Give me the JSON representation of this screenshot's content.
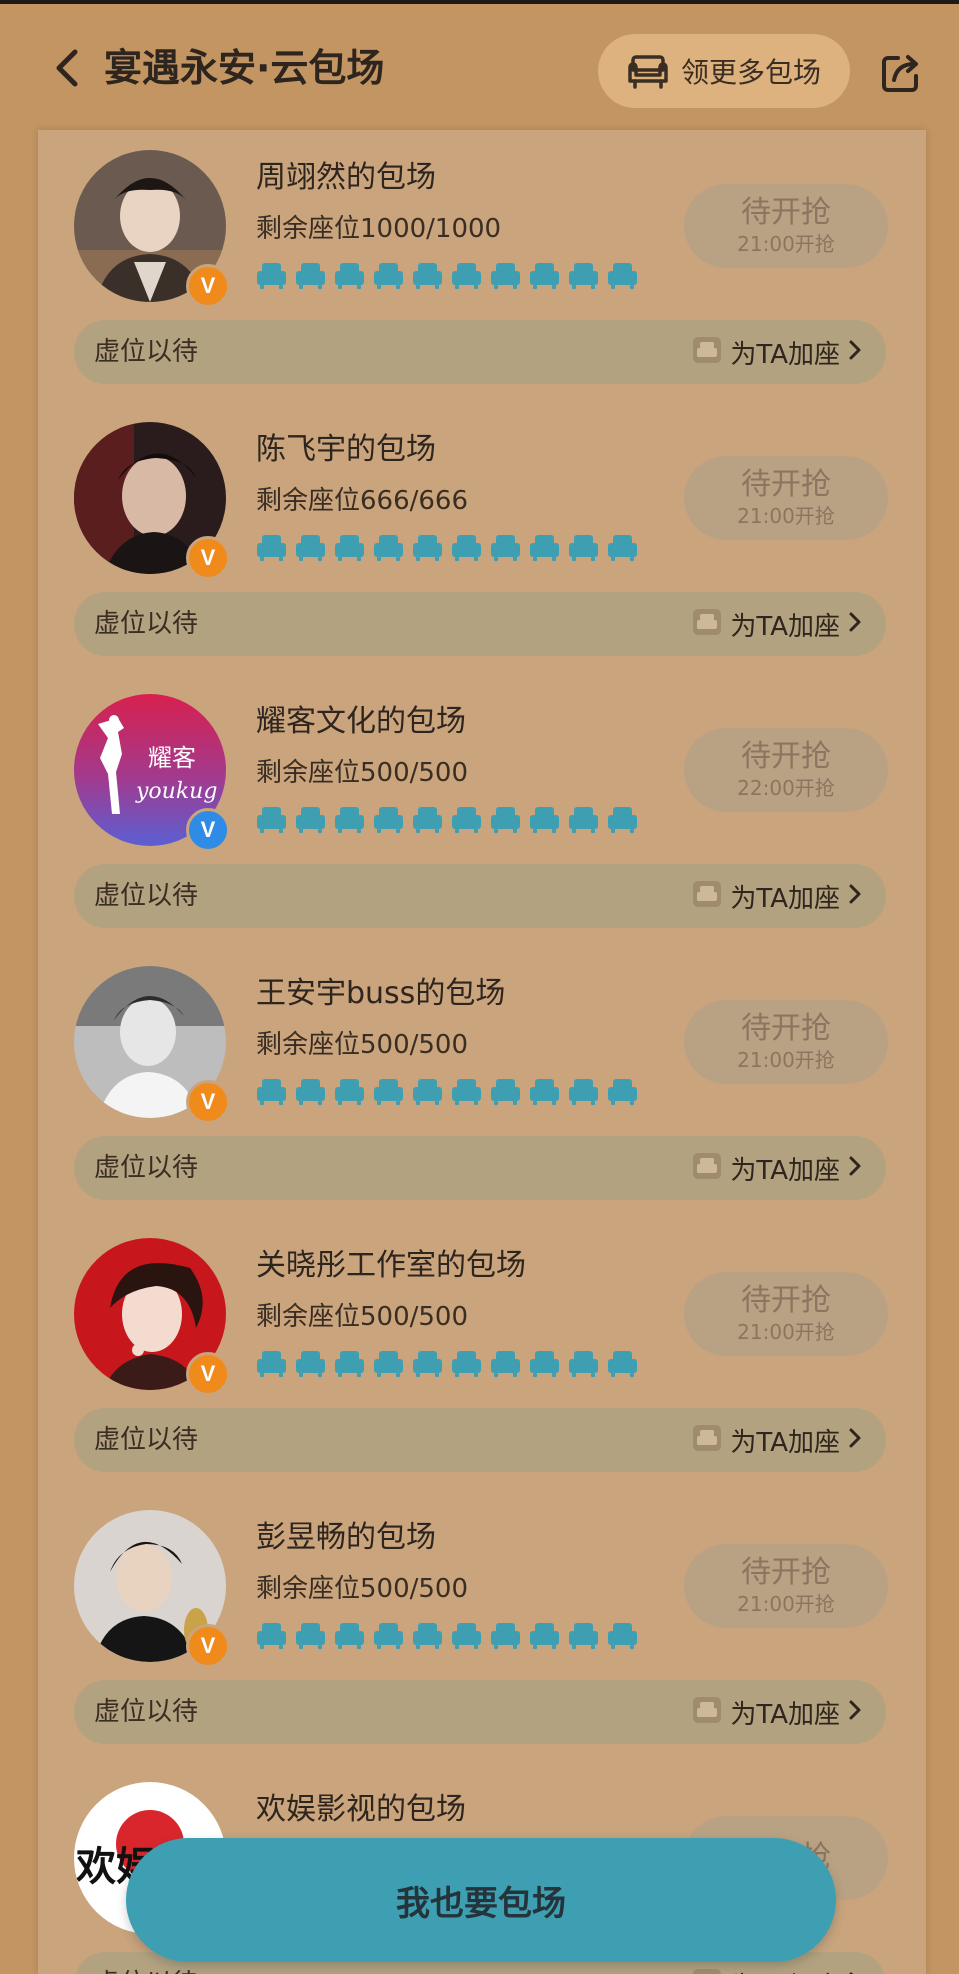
{
  "header": {
    "title": "宴遇永安·云包场",
    "more_button_label": "领更多包场",
    "icons": [
      "back-arrow-icon",
      "sofa-icon",
      "share-icon"
    ]
  },
  "colors": {
    "background": "#C29563",
    "panel": "#C9A47D",
    "seat_icon": "#3E9FB2",
    "cta": "#3E9FB2",
    "verified_orange": "#F08A1A",
    "verified_blue": "#2E8BE6"
  },
  "cards": [
    {
      "name": "周翊然的包场",
      "seats": "剩余座位1000/1000",
      "status": "待开抢",
      "time": "21:00开抢",
      "waiting": "虚位以待",
      "add_seat": "为TA加座",
      "badge": "orange"
    },
    {
      "name": "陈飞宇的包场",
      "seats": "剩余座位666/666",
      "status": "待开抢",
      "time": "21:00开抢",
      "waiting": "虚位以待",
      "add_seat": "为TA加座",
      "badge": "orange"
    },
    {
      "name": "耀客文化的包场",
      "seats": "剩余座位500/500",
      "status": "待开抢",
      "time": "22:00开抢",
      "waiting": "虚位以待",
      "add_seat": "为TA加座",
      "badge": "blue",
      "logo_text": "耀客",
      "logo_subtext": "youkug"
    },
    {
      "name": "王安宇buss的包场",
      "seats": "剩余座位500/500",
      "status": "待开抢",
      "time": "21:00开抢",
      "waiting": "虚位以待",
      "add_seat": "为TA加座",
      "badge": "orange"
    },
    {
      "name": "关晓彤工作室的包场",
      "seats": "剩余座位500/500",
      "status": "待开抢",
      "time": "21:00开抢",
      "waiting": "虚位以待",
      "add_seat": "为TA加座",
      "badge": "orange"
    },
    {
      "name": "彭昱畅的包场",
      "seats": "剩余座位500/500",
      "status": "待开抢",
      "time": "21:00开抢",
      "waiting": "虚位以待",
      "add_seat": "为TA加座",
      "badge": "orange"
    },
    {
      "name": "欢娱影视的包场",
      "seats": "",
      "status": "待开抢",
      "time": "",
      "waiting": "虚位以待",
      "add_seat": "为TA加座",
      "badge": "none",
      "logo_text": "欢娱"
    }
  ],
  "cta_label": "我也要包场"
}
